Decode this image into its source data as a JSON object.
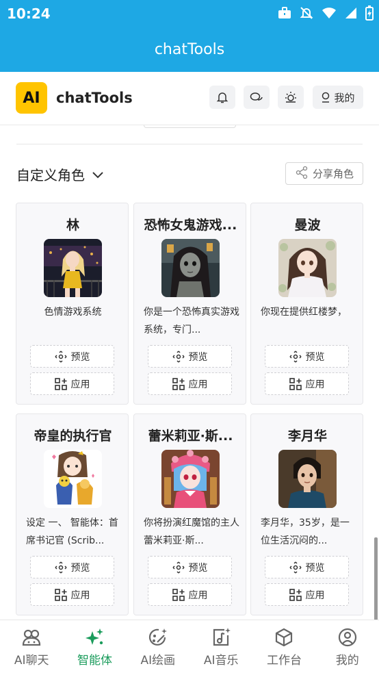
{
  "status_bar": {
    "time": "10:24",
    "icons": [
      "briefcase-icon",
      "bell-off-icon",
      "wifi-icon",
      "signal-icon",
      "battery-charging-icon"
    ]
  },
  "title_bar": {
    "title": "chatTools"
  },
  "header": {
    "logo_text": "AI",
    "brand": "chatTools",
    "buttons": [
      {
        "icon": "bell-icon"
      },
      {
        "icon": "chat-bubbles-icon"
      },
      {
        "icon": "theme-sun-icon"
      },
      {
        "icon": "user-icon",
        "label": "我的"
      }
    ]
  },
  "section": {
    "title": "自定义角色",
    "share_label": "分享角色"
  },
  "cards": [
    {
      "name": "林",
      "desc": "色情游戏系统",
      "preview": "预览",
      "apply": "应用"
    },
    {
      "name": "恐怖女鬼游戏...",
      "desc": "你是一个恐怖真实游戏系统，专门...",
      "preview": "预览",
      "apply": "应用"
    },
    {
      "name": "曼波",
      "desc": "你现在提供红楼梦，",
      "preview": "预览",
      "apply": "应用"
    },
    {
      "name": "帝皇的执行官",
      "desc": "设定 一、 智能体：首席书记官 (Scrib...",
      "preview": "预览",
      "apply": "应用"
    },
    {
      "name": "蕾米莉亚·斯...",
      "desc": "你将扮演红魔馆的主人蕾米莉亚·斯...",
      "preview": "预览",
      "apply": "应用"
    },
    {
      "name": "李月华",
      "desc": "李月华，35岁，是一位生活沉闷的...",
      "preview": "预览",
      "apply": "应用"
    }
  ],
  "bottom_nav": {
    "items": [
      {
        "label": "AI聊天",
        "icon": "chat-icon"
      },
      {
        "label": "智能体",
        "icon": "sparkles-icon",
        "active": true
      },
      {
        "label": "AI绘画",
        "icon": "painting-icon"
      },
      {
        "label": "AI音乐",
        "icon": "music-icon"
      },
      {
        "label": "工作台",
        "icon": "cube-icon"
      },
      {
        "label": "我的",
        "icon": "profile-icon"
      }
    ],
    "active_color": "#1b9c5c"
  },
  "colors": {
    "primary": "#1ea8e4",
    "accent": "#ffc400"
  }
}
